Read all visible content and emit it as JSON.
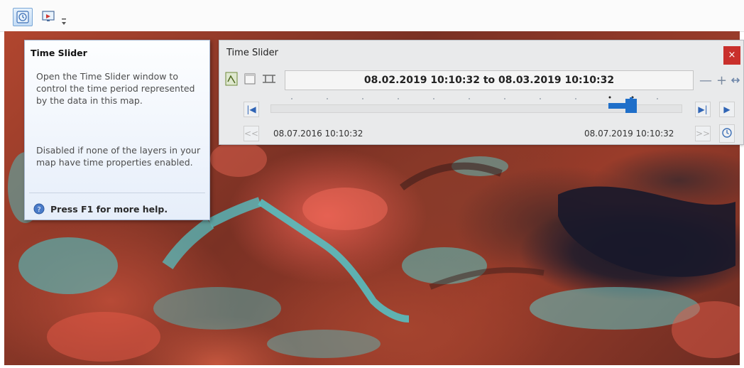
{
  "toolbar": {
    "buttons": [
      {
        "name": "time-slider-button",
        "icon": "clock-icon"
      },
      {
        "name": "desktop-button",
        "icon": "monitor-icon"
      }
    ]
  },
  "time_slider": {
    "title": "Time Slider",
    "close_label": "×",
    "range_text": "08.02.2019 10:10:32 to 08.03.2019 10:10:32",
    "start_label": "08.07.2016 10:10:32",
    "end_label": "08.07.2019 10:10:32",
    "zoom_out_label": "—",
    "zoom_in_label": "+",
    "back_step_label": "<<",
    "forward_step_label": ">>",
    "first_label": "|◀",
    "last_label": "▶|",
    "play_label": "▶",
    "thumb_position": 0.92
  },
  "tooltip": {
    "title": "Time Slider",
    "para1": "Open the Time Slider window to control the time period represented by the data in this map.",
    "para2": "Disabled if none of the layers in your map have time properties enabled.",
    "help": "Press F1 for more help."
  },
  "colors": {
    "close_red": "#c9302c",
    "thumb_blue": "#1f6fc9"
  }
}
